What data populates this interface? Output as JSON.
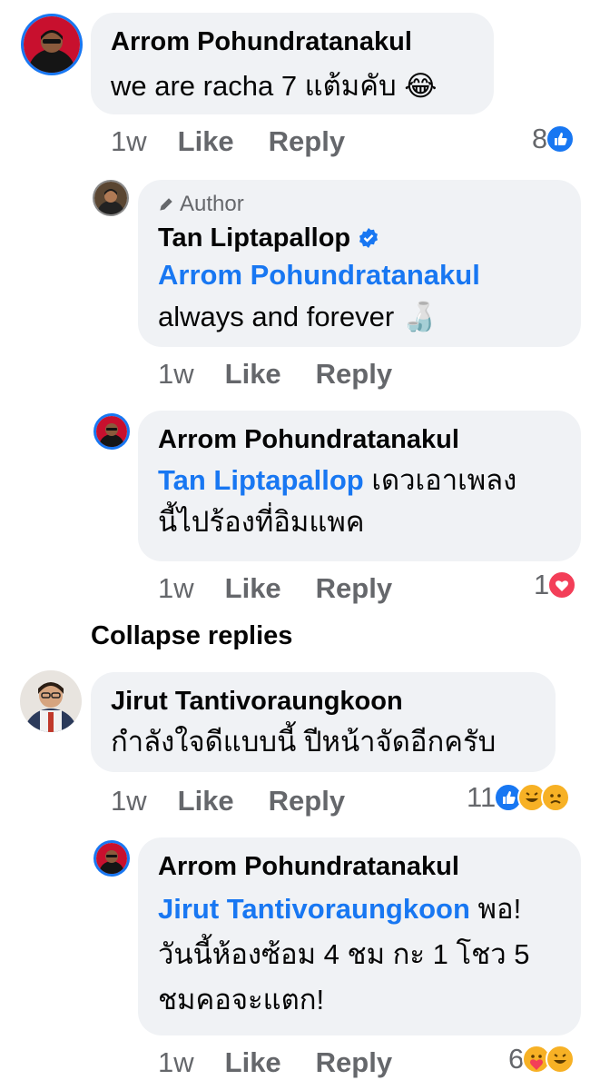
{
  "colors": {
    "link_blue": "#1877f2",
    "bubble_bg": "#f0f2f5",
    "muted_text": "#65676b",
    "love_red": "#f33e58",
    "haha_yellow": "#f7b125"
  },
  "comments": [
    {
      "author": "Arrom Pohundratanakul",
      "text": "we are racha 7 แต้มคับ",
      "emoji": "😂",
      "time": "1w",
      "like": "Like",
      "reply": "Reply",
      "reaction_count": "8",
      "reactions": [
        "like-icon"
      ]
    },
    {
      "author_tag": "Author",
      "author": "Tan Liptapallop",
      "verified": true,
      "mention": "Arrom Pohundratanakul",
      "text": "always and forever",
      "emoji": "🍶",
      "time": "1w",
      "like": "Like",
      "reply": "Reply"
    },
    {
      "author": "Arrom Pohundratanakul",
      "mention": "Tan Liptapallop",
      "text_line1": "เดวเอาเพลง",
      "text_line2": "นี้ไปร้องที่อิมแพค",
      "time": "1w",
      "like": "Like",
      "reply": "Reply",
      "reaction_count": "1",
      "reactions": [
        "love-icon"
      ]
    },
    {
      "author": "Jirut Tantivoraungkoon",
      "text": "กำลังใจดีแบบนี้ ปีหน้าจัดอีกครับ",
      "time": "1w",
      "like": "Like",
      "reply": "Reply",
      "reaction_count": "11",
      "reactions": [
        "like-icon",
        "haha-icon",
        "sad-icon"
      ]
    },
    {
      "author": "Arrom Pohundratanakul",
      "mention": "Jirut Tantivoraungkoon",
      "text_line1_after": "พอ!",
      "text_line2": "วันนี้ห้องซ้อม 4 ชม กะ 1 โชว 5",
      "text_line3": "ชมคอจะแตก!",
      "time": "1w",
      "like": "Like",
      "reply": "Reply",
      "reaction_count": "6",
      "reactions": [
        "care-icon",
        "haha-icon"
      ]
    }
  ],
  "collapse_label": "Collapse replies"
}
